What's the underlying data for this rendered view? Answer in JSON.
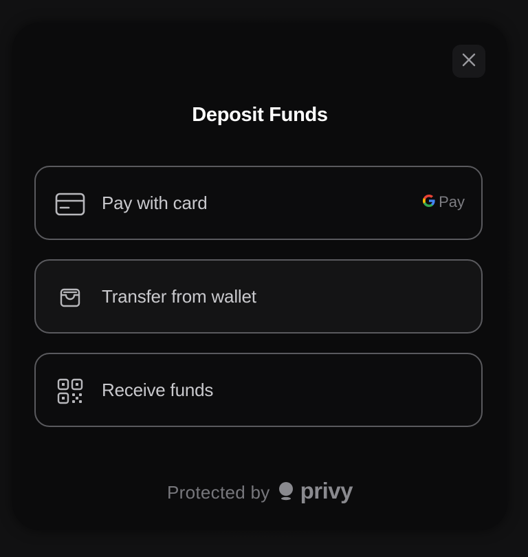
{
  "modal": {
    "title": "Deposit Funds",
    "close_icon": "close-icon"
  },
  "options": [
    {
      "label": "Pay with card",
      "icon": "credit-card-icon",
      "badge": "Pay",
      "badge_icon": "google-g-icon"
    },
    {
      "label": "Transfer from wallet",
      "icon": "wallet-icon"
    },
    {
      "label": "Receive funds",
      "icon": "qr-code-icon"
    }
  ],
  "footer": {
    "protected_by": "Protected by",
    "brand": "privy"
  },
  "colors": {
    "background": "#0b0b0c",
    "border": "#5a5a5e",
    "title": "#ffffff",
    "label": "#c9c9cd",
    "muted": "#77777c"
  }
}
